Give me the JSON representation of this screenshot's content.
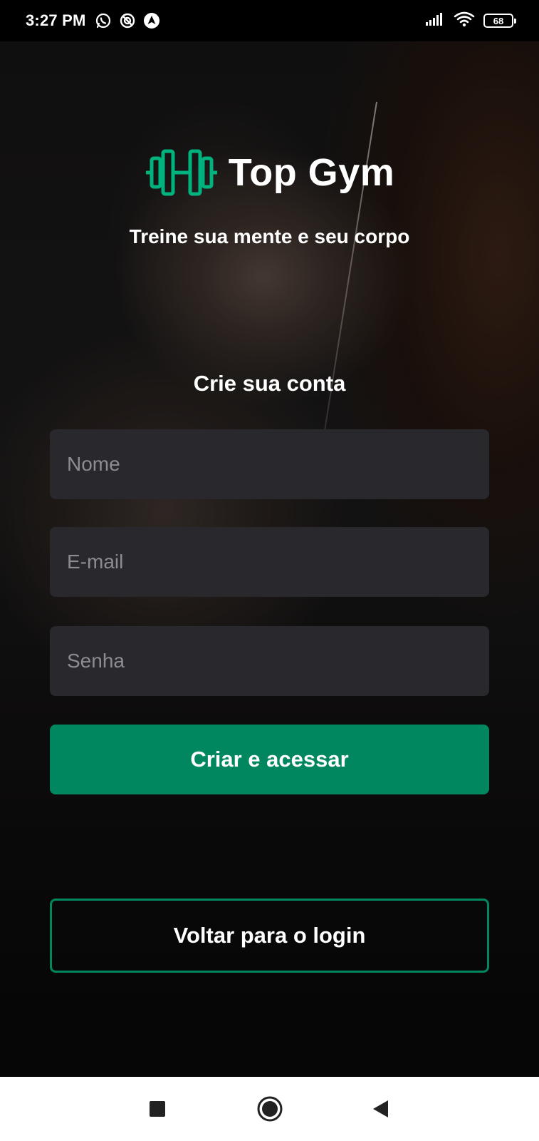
{
  "status_bar": {
    "time": "3:27 PM",
    "battery_level": "68",
    "icons": [
      "whatsapp-icon",
      "sync-icon",
      "nav-arrow-icon",
      "signal-icon",
      "wifi-icon",
      "battery-icon"
    ]
  },
  "brand": {
    "title": "Top Gym",
    "tagline": "Treine sua mente e seu corpo",
    "logo_icon": "dumbbell-icon",
    "accent_color": "#00875f",
    "logo_color": "#00b37e"
  },
  "form": {
    "title": "Crie sua conta",
    "fields": {
      "name": {
        "placeholder": "Nome",
        "value": ""
      },
      "email": {
        "placeholder": "E-mail",
        "value": ""
      },
      "password": {
        "placeholder": "Senha",
        "value": ""
      }
    },
    "submit_label": "Criar e acessar"
  },
  "back_to_login_label": "Voltar para o login",
  "nav_bar": {
    "icons": [
      "square-recents-icon",
      "circle-home-icon",
      "triangle-back-icon"
    ]
  },
  "colors": {
    "field_background": "#29282d",
    "placeholder": "#8d8c92",
    "text": "#ffffff"
  }
}
